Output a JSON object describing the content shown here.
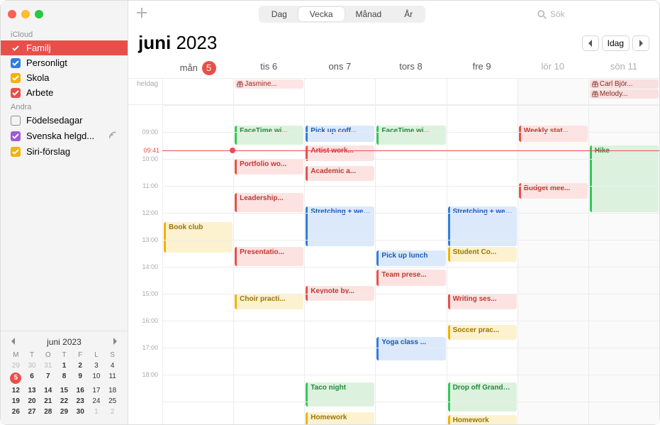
{
  "sidebar": {
    "sections": [
      {
        "label": "iCloud",
        "items": [
          {
            "name": "Familj",
            "color": "#e94f4a",
            "checked": true,
            "selected": true
          },
          {
            "name": "Personligt",
            "color": "#2f7de0",
            "checked": true
          },
          {
            "name": "Skola",
            "color": "#f2b202",
            "checked": true
          },
          {
            "name": "Arbete",
            "color": "#e94f4a",
            "checked": true
          }
        ]
      },
      {
        "label": "Andra",
        "items": [
          {
            "name": "Födelsedagar",
            "color": "#8e8e93",
            "checked": false
          },
          {
            "name": "Svenska helgd...",
            "color": "#a259d9",
            "checked": true,
            "broadcast": true
          },
          {
            "name": "Siri-förslag",
            "color": "#f2b202",
            "checked": true
          }
        ]
      }
    ]
  },
  "miniCal": {
    "title": "juni 2023",
    "dow": [
      "M",
      "T",
      "O",
      "T",
      "F",
      "L",
      "S"
    ],
    "weeks": [
      [
        {
          "d": 29,
          "dim": true
        },
        {
          "d": 30,
          "dim": true
        },
        {
          "d": 31,
          "dim": true
        },
        {
          "d": 1,
          "bold": true
        },
        {
          "d": 2,
          "bold": true
        },
        {
          "d": 3
        },
        {
          "d": 4
        }
      ],
      [
        {
          "d": 5,
          "today": true,
          "bold": true
        },
        {
          "d": 6,
          "bold": true
        },
        {
          "d": 7,
          "bold": true
        },
        {
          "d": 8,
          "bold": true
        },
        {
          "d": 9,
          "bold": true
        },
        {
          "d": 10
        },
        {
          "d": 11
        }
      ],
      [
        {
          "d": 12,
          "bold": true
        },
        {
          "d": 13,
          "bold": true
        },
        {
          "d": 14,
          "bold": true
        },
        {
          "d": 15,
          "bold": true
        },
        {
          "d": 16,
          "bold": true
        },
        {
          "d": 17
        },
        {
          "d": 18
        }
      ],
      [
        {
          "d": 19,
          "bold": true
        },
        {
          "d": 20,
          "bold": true
        },
        {
          "d": 21,
          "bold": true
        },
        {
          "d": 22,
          "bold": true
        },
        {
          "d": 23,
          "bold": true
        },
        {
          "d": 24
        },
        {
          "d": 25
        }
      ],
      [
        {
          "d": 26,
          "bold": true
        },
        {
          "d": 27,
          "bold": true
        },
        {
          "d": 28,
          "bold": true
        },
        {
          "d": 29,
          "bold": true
        },
        {
          "d": 30,
          "bold": true
        },
        {
          "d": 1,
          "dim": true
        },
        {
          "d": 2,
          "dim": true
        }
      ]
    ]
  },
  "toolbar": {
    "views": {
      "day": "Dag",
      "week": "Vecka",
      "month": "Månad",
      "year": "År"
    },
    "active": "week",
    "searchPlaceholder": "Sök"
  },
  "header": {
    "month": "juni",
    "year": "2023",
    "todayLabel": "Idag"
  },
  "days": [
    {
      "dow": "mån",
      "num": 5,
      "today": true
    },
    {
      "dow": "tis",
      "num": 6
    },
    {
      "dow": "ons",
      "num": 7
    },
    {
      "dow": "tors",
      "num": 8
    },
    {
      "dow": "fre",
      "num": 9
    },
    {
      "dow": "lör",
      "num": 10,
      "weekend": true
    },
    {
      "dow": "sön",
      "num": 11,
      "weekend": true
    }
  ],
  "alldayLabel": "heldag",
  "allday": [
    [],
    [
      {
        "title": "Jasmine...",
        "cal": "red",
        "gift": true
      }
    ],
    [],
    [],
    [],
    [],
    [
      {
        "title": "Carl Björ...",
        "cal": "red",
        "gift": true
      },
      {
        "title": "Melody...",
        "cal": "red",
        "gift": true
      }
    ]
  ],
  "timeStart": 8,
  "hourHeight": 38,
  "hours": [
    "09:00",
    "10:00",
    "11:00",
    "12:00",
    "13:00",
    "14:00",
    "15:00",
    "16:00",
    "17:00",
    "18:00"
  ],
  "now": {
    "label": "09:41",
    "hour": 9.683
  },
  "events": [
    {
      "day": 0,
      "start": 12.33,
      "end": 13.5,
      "title": "Book club",
      "cal": "yellow"
    },
    {
      "day": 1,
      "start": 8.75,
      "end": 9.5,
      "title": "FaceTime wi...",
      "cal": "green"
    },
    {
      "day": 1,
      "start": 10.0,
      "end": 10.6,
      "title": "Portfolio wo...",
      "cal": "red"
    },
    {
      "day": 1,
      "start": 11.25,
      "end": 12.0,
      "title": "Leadership...",
      "cal": "red"
    },
    {
      "day": 1,
      "start": 13.25,
      "end": 14.0,
      "title": "Presentatio...",
      "cal": "red"
    },
    {
      "day": 1,
      "start": 15.0,
      "end": 15.6,
      "title": "Choir practi...",
      "cal": "yellow"
    },
    {
      "day": 2,
      "start": 8.75,
      "end": 9.4,
      "title": "Pick up coff...",
      "cal": "blue"
    },
    {
      "day": 2,
      "start": 9.5,
      "end": 10.1,
      "title": "Artist work...",
      "cal": "red"
    },
    {
      "day": 2,
      "start": 10.25,
      "end": 10.85,
      "title": "Academic a...",
      "cal": "red"
    },
    {
      "day": 2,
      "start": 11.75,
      "end": 13.25,
      "title": "Stretching + weights",
      "cal": "blue"
    },
    {
      "day": 2,
      "start": 14.7,
      "end": 15.3,
      "title": "Keynote by...",
      "cal": "red"
    },
    {
      "day": 2,
      "start": 18.3,
      "end": 19.2,
      "title": "Taco night",
      "cal": "green"
    },
    {
      "day": 2,
      "start": 19.4,
      "end": 20.0,
      "title": "Homework",
      "cal": "yellow"
    },
    {
      "day": 3,
      "start": 8.75,
      "end": 9.5,
      "title": "FaceTime wi...",
      "cal": "green"
    },
    {
      "day": 3,
      "start": 13.4,
      "end": 14.0,
      "title": "Pick up lunch",
      "cal": "blue"
    },
    {
      "day": 3,
      "start": 14.1,
      "end": 14.75,
      "title": "Team prese...",
      "cal": "red"
    },
    {
      "day": 3,
      "start": 16.6,
      "end": 17.5,
      "title": "Yoga class  ...",
      "cal": "blue"
    },
    {
      "day": 4,
      "start": 11.75,
      "end": 13.25,
      "title": "Stretching + weights",
      "cal": "blue"
    },
    {
      "day": 4,
      "start": 13.25,
      "end": 13.85,
      "title": "Student Co...",
      "cal": "yellow"
    },
    {
      "day": 4,
      "start": 15.0,
      "end": 15.6,
      "title": "Writing ses...",
      "cal": "red"
    },
    {
      "day": 4,
      "start": 16.15,
      "end": 16.75,
      "title": "Soccer prac...",
      "cal": "yellow"
    },
    {
      "day": 4,
      "start": 18.3,
      "end": 19.4,
      "title": "Drop off Grandma...",
      "cal": "green"
    },
    {
      "day": 4,
      "start": 19.5,
      "end": 20.0,
      "title": "Homework",
      "cal": "yellow"
    },
    {
      "day": 5,
      "start": 8.75,
      "end": 9.4,
      "title": "Weekly stat...",
      "cal": "red"
    },
    {
      "day": 5,
      "start": 10.9,
      "end": 11.5,
      "title": "Budget mee...",
      "cal": "red"
    },
    {
      "day": 6,
      "start": 9.5,
      "end": 12.0,
      "title": "Hike",
      "cal": "green"
    }
  ]
}
